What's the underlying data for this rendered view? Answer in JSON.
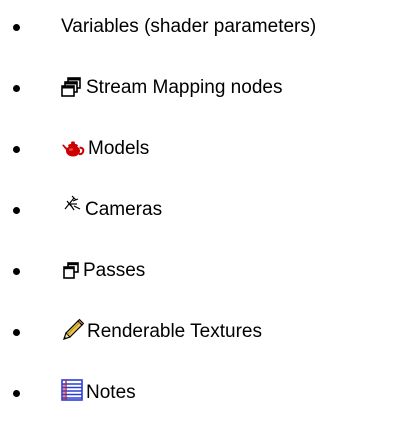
{
  "list": {
    "items": [
      {
        "label": "Variables (shader parameters)",
        "icon": "none"
      },
      {
        "label": "Stream Mapping nodes",
        "icon": "stacked-windows-icon"
      },
      {
        "label": "Models",
        "icon": "teapot-icon"
      },
      {
        "label": "Cameras",
        "icon": "camera-icon"
      },
      {
        "label": "Passes",
        "icon": "passes-icon"
      },
      {
        "label": "Renderable Textures",
        "icon": "pencil-icon"
      },
      {
        "label": "Notes",
        "icon": "notes-icon"
      }
    ]
  },
  "colors": {
    "text": "#000000",
    "teapot": "#cc0000",
    "pencil": "#e8c84a",
    "notes_blue": "#2b3fd6",
    "notes_red": "#d02020"
  }
}
